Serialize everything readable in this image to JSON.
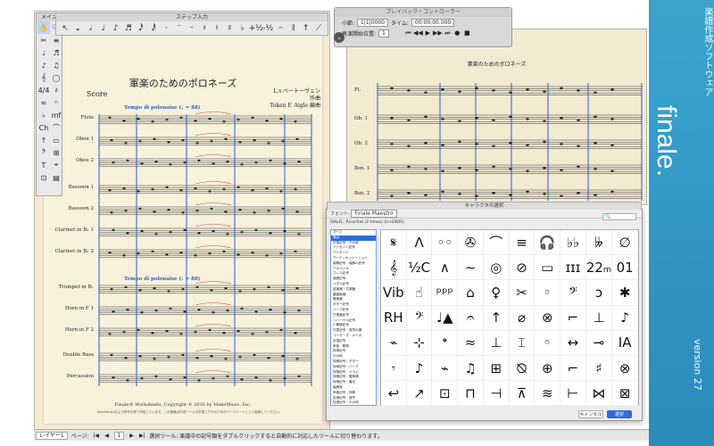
{
  "palette": {
    "title": "メイン",
    "tools": [
      "✋",
      "🔍",
      "✂",
      "≡",
      "♩",
      "♬",
      "♪",
      "♫",
      "𝄞",
      "◯",
      "4/4",
      "♯",
      "≈",
      "𝄐",
      "♭",
      "mf",
      "Ch",
      "⌒",
      "↑",
      "▭",
      "𝄢",
      "⊞",
      "T",
      "⌖",
      "⊡",
      "▤"
    ]
  },
  "step_entry": {
    "title": "ステップ入力",
    "symbols": [
      "↖",
      "𝅝",
      "𝅗𝅥",
      "♩",
      "♪",
      "♬",
      "𝅘𝅥𝅰",
      "𝅘𝅥𝅱",
      "·",
      "𝄻",
      "𝄼",
      "𝄽",
      "♮",
      "♯",
      "♭",
      "+½",
      "-½",
      "𝄐",
      "𝄂",
      "↑",
      "⟋"
    ]
  },
  "playback": {
    "title": "プレイバック・コントローラー",
    "measure_label": "小節:",
    "measure_value": "1|1|0000",
    "time_label": "タイム:",
    "time_value": "00:00:00.000",
    "start_label": "再演開始位置:",
    "start_value": "1",
    "controls": [
      "⏮",
      "◀◀",
      "▶",
      "▶▶",
      "⏭",
      "●",
      "■"
    ],
    "close_icon": "⌄"
  },
  "score_main": {
    "title": "軍楽のためのポロネーズ",
    "score_label": "Score",
    "composer_line1": "L.v.ベートーヴェン 作曲",
    "composer_line2": "Token F. Aigle 編曲",
    "tempo1": "Tempo di polonaise (♩ = 88)",
    "tempo2": "Tempo di polonaise (♩ = 88)",
    "instruments": [
      "Flute",
      "Oboe 1",
      "Oboe 2",
      "Bassoon 1",
      "Bassoon 2",
      "Clarinet in B♭ 1",
      "Clarinet in B♭ 2",
      "Trumpet in B♭",
      "Horn in F 1",
      "Horn in F 2",
      "Double Bass",
      "Percussion"
    ],
    "copyright": "Finale® Worksheets, Copyright © 2016 by MakeMusic, Inc.",
    "footnote": "MakeMusic社より許可を得て作成しています。この楽譜は作成ツールの学習とデモのためのワークシートとして使用してください。"
  },
  "score_secondary": {
    "title": "軍楽のためのポロネーズ",
    "instruments": [
      "Fl.",
      "Ob. 1",
      "Ob. 2",
      "Bsn. 1",
      "Bsn. 2"
    ]
  },
  "dialog": {
    "title": "キャラクタの選択",
    "font_label": "フォント:",
    "font_value": "Finale Maestro",
    "subset_label": "SMuFL: Ricochet (2 times) (U+E8D0)",
    "search_placeholder": "🔍",
    "categories": [
      "すべて",
      "最近",
      "付属記号・その他",
      "アクセント記号",
      "アクセント",
      "アーティキュレーション",
      "装飾記号・装飾の記号",
      "アルペジオ",
      "ブレス記号",
      "強弱記号",
      "ペダル記号",
      "弦楽器・打楽器",
      "鍵盤楽器",
      "管楽器",
      "ギター記号",
      "ハープ記号",
      "打楽器記号",
      "リハーサル記号",
      "小節線記号",
      "付属記号・音符の頭",
      "コーダ・ダ・カーポ",
      "反復記号",
      "声楽・歌詞",
      "特殊記号",
      "その他",
      "特殊記号・ギター",
      "特殊記号・ハープ",
      "特殊記号・ドラム",
      "特殊記号・管楽器",
      "特殊記号・奏法",
      "装飾音",
      "声楽記号・特殊",
      "拡張記号・音符",
      "拡張記号・その他"
    ],
    "selected_category_index": 1,
    "glyphs": [
      "𝄋",
      "Λ",
      "◦◦",
      "✇",
      "⌒",
      "≡",
      "🎧",
      "♭♭",
      "𝄫",
      "∅",
      "𝄞",
      "½C",
      "∧",
      "~",
      "◎",
      "⊘",
      "▭",
      "ɪɪɪ",
      "22ₘ",
      "01",
      "Vib",
      "☝",
      "ᵖᵖᵖ",
      "⌂",
      "♀",
      "✂",
      "◦",
      "𝄢",
      "ↄ",
      "✱",
      "RH",
      "𝄢",
      "♩▲",
      "𝄐",
      "↑",
      "⌀",
      "⊗",
      "⌐",
      "⊥",
      "♪",
      "⌁",
      "⊹",
      "𝄌",
      "≈",
      "⊥",
      "⌶",
      "◦",
      "↔",
      "⊸",
      "IA",
      "𝄾",
      "♪",
      "⌁",
      "♫",
      "⊞",
      "⦰",
      "⊕",
      "⌐",
      "♯",
      "⊗",
      "↩",
      "↗",
      "⊡",
      "⊓",
      "⊣",
      "⊼",
      "≋",
      "⊢",
      "⋈",
      "⊠"
    ],
    "cancel_label": "キャンセル",
    "ok_label": "選択"
  },
  "brand": {
    "name": "finale.",
    "tagline": "楽譜作成ソフトウェア",
    "version": "version 27"
  },
  "status": {
    "layer_label": "レイヤー1",
    "page_label": "ページ:",
    "page_value": "1",
    "message": "選択ツール: 楽譜中の記号類をダブルクリックすると自動的に対応したツールに切り替わります。",
    "nav": [
      "|◀",
      "◀",
      "▶",
      "▶|"
    ]
  }
}
